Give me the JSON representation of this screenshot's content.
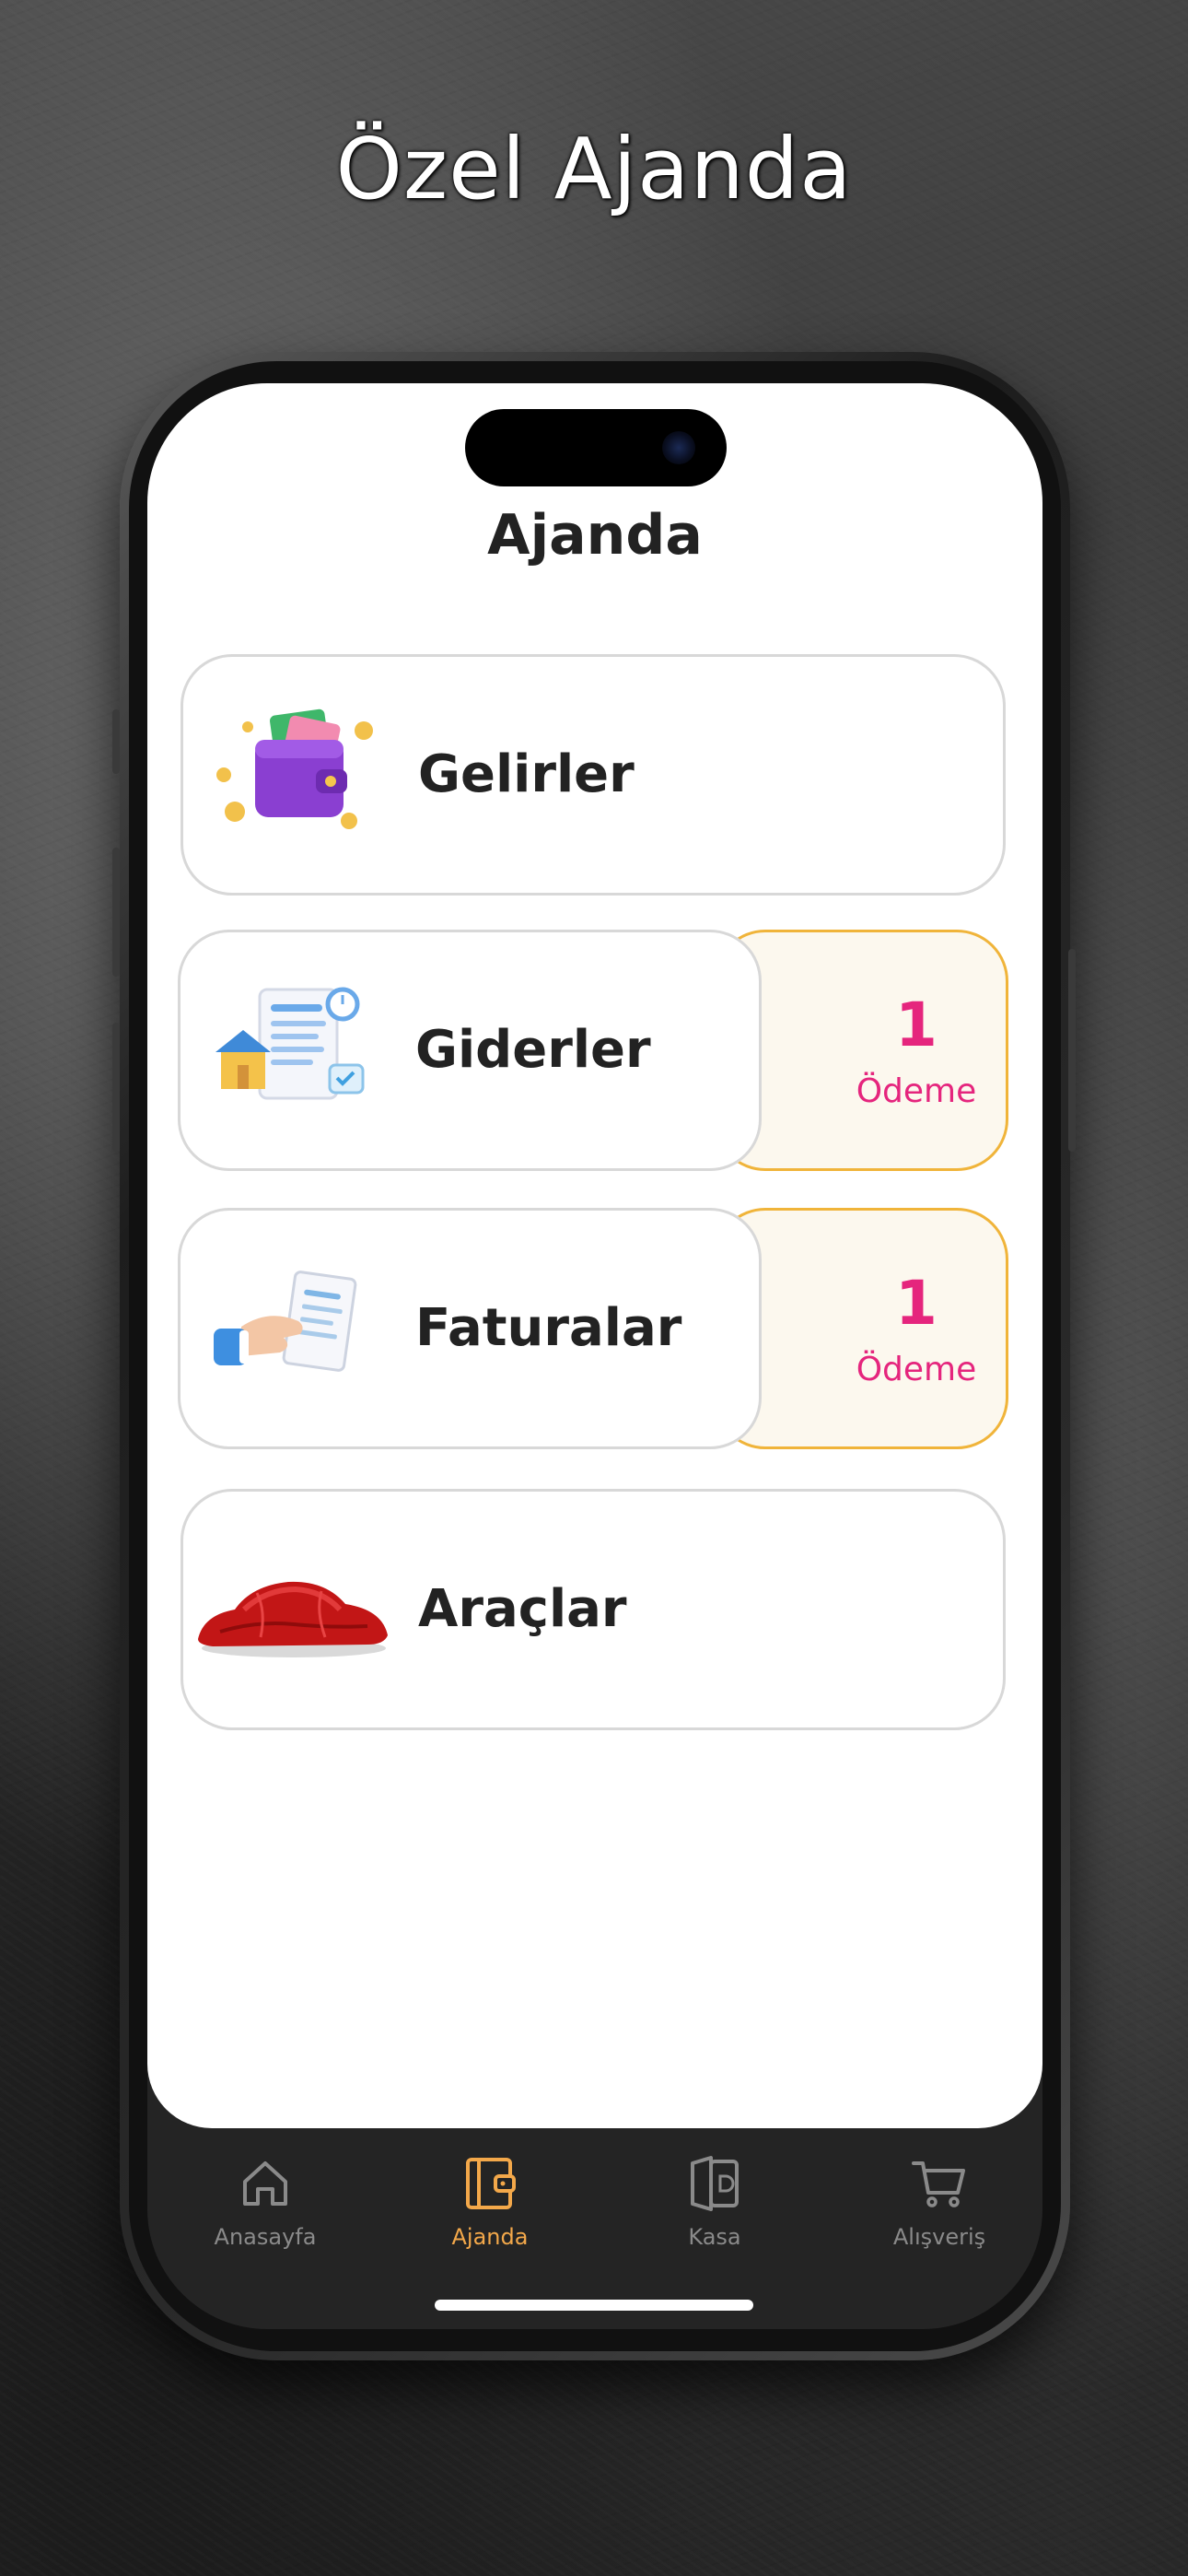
{
  "promo": {
    "headline": "Özel Ajanda"
  },
  "screen": {
    "title": "Ajanda",
    "cards": [
      {
        "label": "Gelirler",
        "icon": "wallet-icon"
      },
      {
        "label": "Giderler",
        "icon": "expense-document-icon",
        "badge": {
          "count": "1",
          "unit": "Ödeme"
        }
      },
      {
        "label": "Faturalar",
        "icon": "invoice-hand-icon",
        "badge": {
          "count": "1",
          "unit": "Ödeme"
        }
      },
      {
        "label": "Araçlar",
        "icon": "covered-car-icon"
      }
    ]
  },
  "tabbar": {
    "active_color": "#f3a84a",
    "items": [
      {
        "label": "Anasayfa",
        "icon": "home-icon"
      },
      {
        "label": "Ajanda",
        "icon": "wallet-book-icon",
        "active": true
      },
      {
        "label": "Kasa",
        "icon": "safe-icon"
      },
      {
        "label": "Alışveriş",
        "icon": "cart-icon"
      }
    ]
  },
  "colors": {
    "badge_text": "#e5257d",
    "badge_border": "#f0b43a",
    "badge_bg": "#fcf8ee"
  }
}
